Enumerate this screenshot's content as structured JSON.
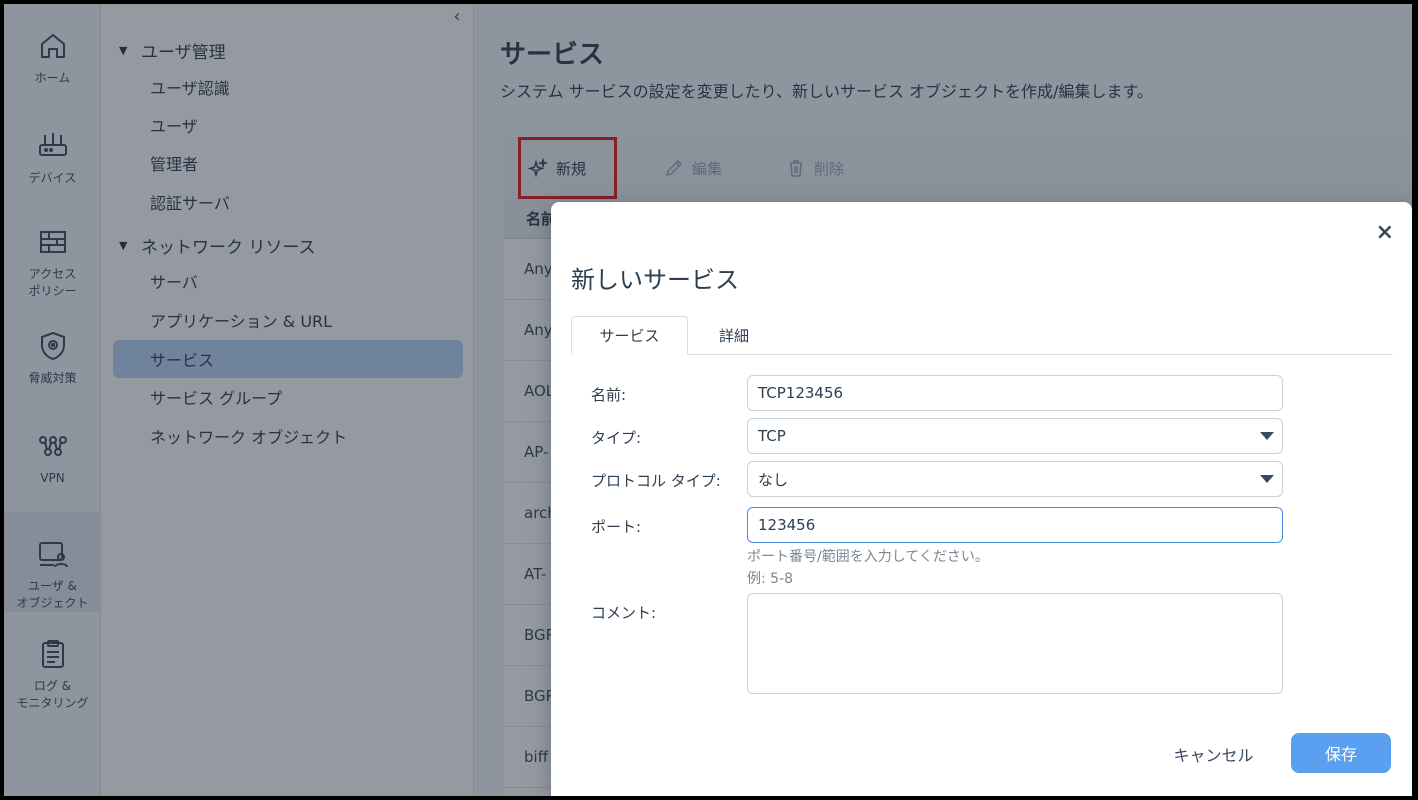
{
  "rail": [
    {
      "label": "ホーム",
      "icon": "home-icon"
    },
    {
      "label": "デバイス",
      "icon": "router-icon"
    },
    {
      "label": "アクセス\nポリシー",
      "icon": "firewall-icon"
    },
    {
      "label": "脅威対策",
      "icon": "shield-icon"
    },
    {
      "label": "VPN",
      "icon": "vpn-icon"
    },
    {
      "label": "ユーザ &\nオブジェクト",
      "icon": "user-object-icon"
    },
    {
      "label": "ログ &\nモニタリング",
      "icon": "clipboard-icon"
    }
  ],
  "nav": {
    "collapse_icon": "‹",
    "groups": [
      {
        "label": "ユーザ管理",
        "items": [
          "ユーザ認識",
          "ユーザ",
          "管理者",
          "認証サーバ"
        ]
      },
      {
        "label": "ネットワーク リソース",
        "items": [
          "サーバ",
          "アプリケーション & URL",
          "サービス",
          "サービス グループ",
          "ネットワーク オブジェクト"
        ]
      }
    ],
    "selected": "サービス"
  },
  "page": {
    "title": "サービス",
    "subtitle": "システム サービスの設定を変更したり、新しいサービス オブジェクトを作成/編集します。"
  },
  "toolbar": {
    "new_label": "新規",
    "edit_label": "編集",
    "delete_label": "削除"
  },
  "table": {
    "header": "名前",
    "rows": [
      "Any",
      "Any",
      "AOL",
      "AP-",
      "arch",
      "AT-",
      "BGP",
      "BGP",
      "biff"
    ]
  },
  "dialog": {
    "title": "新しいサービス",
    "close": "×",
    "tabs": [
      "サービス",
      "詳細"
    ],
    "fields": {
      "name_label": "名前:",
      "name_value": "TCP123456",
      "type_label": "タイプ:",
      "type_value": "TCP",
      "protocol_label": "プロトコル タイプ:",
      "protocol_value": "なし",
      "port_label": "ポート:",
      "port_value": "123456",
      "port_hint": "ポート番号/範囲を入力してください。",
      "port_example": "例: 5-8",
      "comment_label": "コメント:"
    },
    "cancel_label": "キャンセル",
    "save_label": "保存"
  },
  "colors": {
    "accent": "#5b9ff0",
    "highlight_box": "#e0191b",
    "nav_selected": "#b9d4f5"
  }
}
